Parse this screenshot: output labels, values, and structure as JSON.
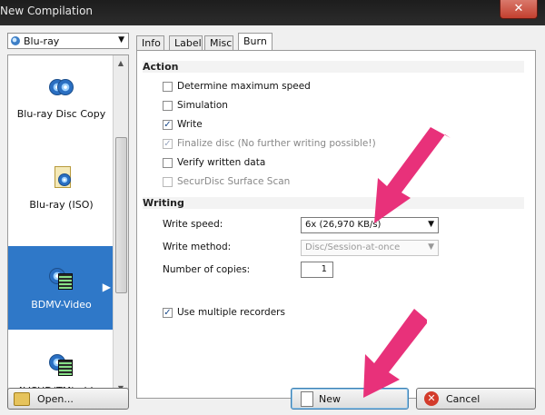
{
  "window": {
    "title": "New Compilation",
    "close_glyph": "✕"
  },
  "category_select": {
    "value": "Blu-ray",
    "icon": "bluray-disc-icon",
    "caret": "▼"
  },
  "recorder_list": {
    "items": [
      {
        "label": "Blu-ray Disc Copy",
        "icon": "disc-copy-icon",
        "selected": false
      },
      {
        "label": "Blu-ray (ISO)",
        "icon": "iso-file-icon",
        "selected": false
      },
      {
        "label": "BDMV-Video",
        "icon": "bdmv-video-icon",
        "selected": true
      },
      {
        "label": "AVCHD(TM) video",
        "icon": "avchd-video-icon",
        "selected": false
      }
    ],
    "selected_arrow": "▶",
    "scroll_up": "▲",
    "scroll_down": "▼"
  },
  "tabs": [
    {
      "label": "Info",
      "active": false
    },
    {
      "label": "Label",
      "active": false
    },
    {
      "label": "Misc",
      "active": false
    },
    {
      "label": "Burn",
      "active": true
    }
  ],
  "burn": {
    "action_header": "Action",
    "options": [
      {
        "label": "Determine maximum speed",
        "checked": false,
        "disabled": false
      },
      {
        "label": "Simulation",
        "checked": false,
        "disabled": false
      },
      {
        "label": "Write",
        "checked": true,
        "disabled": false
      },
      {
        "label": "Finalize disc (No further writing possible!)",
        "checked": true,
        "disabled": true
      },
      {
        "label": "Verify written data",
        "checked": false,
        "disabled": false
      },
      {
        "label": "SecurDisc Surface Scan",
        "checked": false,
        "disabled": true
      }
    ],
    "writing_header": "Writing",
    "write_speed_label": "Write speed:",
    "write_speed_value": "6x (26,970 KB/s)",
    "write_method_label": "Write method:",
    "write_method_value": "Disc/Session-at-once",
    "copies_label": "Number of copies:",
    "copies_value": "1",
    "multi_recorders_label": "Use multiple recorders",
    "multi_recorders_checked": true,
    "check_glyph": "✓",
    "caret": "▼"
  },
  "buttons": {
    "open_label": "Open...",
    "new_label": "New",
    "cancel_label": "Cancel",
    "cancel_glyph": "✕"
  },
  "annotation_color": "#e8317a"
}
